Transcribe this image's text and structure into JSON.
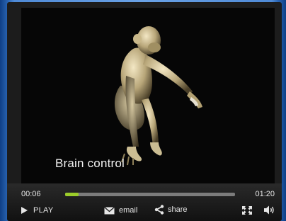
{
  "video": {
    "caption": "Brain control"
  },
  "player": {
    "current_time": "00:06",
    "total_time": "01:20",
    "progress_fraction": 0.08,
    "progress_color": "#9ccd2a",
    "play_label": "PLAY",
    "email_label": "email",
    "share_label": "share",
    "icons": [
      "play-icon",
      "email-icon",
      "share-icon",
      "fullscreen-icon",
      "volume-icon"
    ]
  }
}
